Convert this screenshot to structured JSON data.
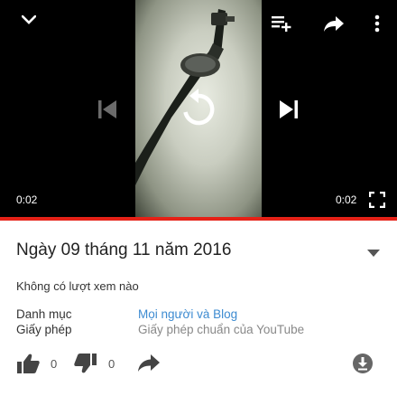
{
  "player": {
    "current_time": "0:02",
    "total_time": "0:02",
    "progress_percent": 100,
    "accent_color": "#e62117",
    "icons": {
      "collapse": "chevron-down-icon",
      "playlist": "add-to-playlist-icon",
      "share": "share-icon",
      "more": "more-vert-icon",
      "previous": "skip-previous-icon",
      "replay": "replay-icon",
      "next": "skip-next-icon",
      "fullscreen": "fullscreen-icon"
    }
  },
  "video": {
    "title": "Ngày 09 tháng 11 năm 2016",
    "views": "Không có lượt xem nào",
    "meta": [
      {
        "key": "Danh mục",
        "value": "Mọi người và Blog"
      },
      {
        "key": "Giấy phép",
        "value": "Giấy phép chuẩn của YouTube"
      }
    ]
  },
  "actions": {
    "likes": "0",
    "dislikes": "0",
    "icons": {
      "like": "thumb-up-icon",
      "dislike": "thumb-down-icon",
      "share": "share-icon",
      "download": "download-icon"
    }
  }
}
